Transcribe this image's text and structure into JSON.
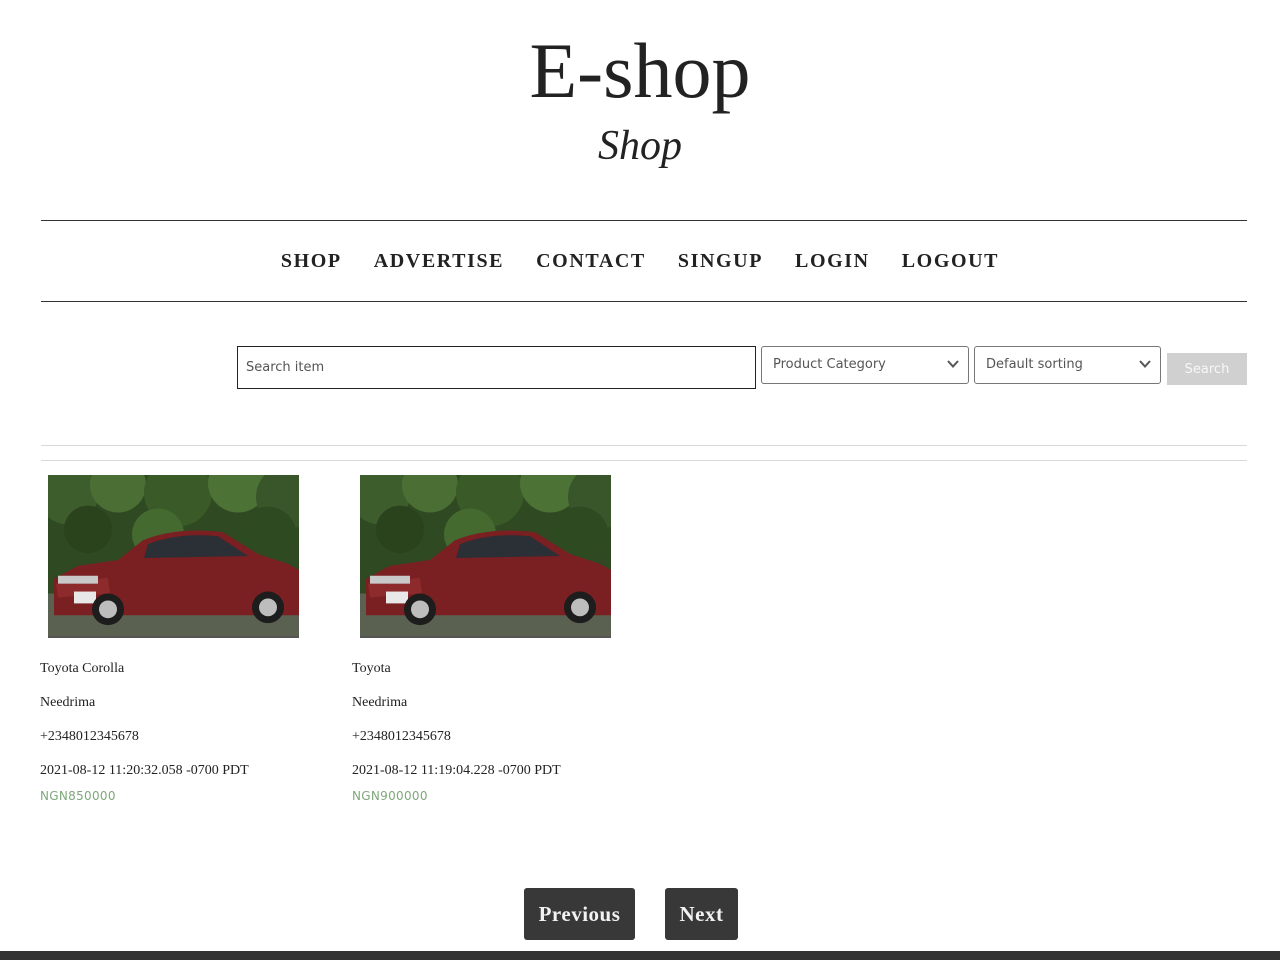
{
  "site": {
    "title": "E-shop",
    "subtitle": "Shop"
  },
  "nav": {
    "items": [
      "SHOP",
      "ADVERTISE",
      "CONTACT",
      "SINGUP",
      "LOGIN",
      "LOGOUT"
    ]
  },
  "filters": {
    "search_placeholder": "Search item",
    "search_value": "",
    "category_selected": "Product Category",
    "sorting_selected": "Default sorting",
    "search_button": "Search"
  },
  "products": [
    {
      "name": "Toyota Corolla",
      "seller": "Needrima",
      "phone": "+2348012345678",
      "date": "2021-08-12 11:20:32.058 -0700 PDT",
      "price": "NGN850000",
      "image_icon": "red-sedan-car-photo"
    },
    {
      "name": "Toyota",
      "seller": "Needrima",
      "phone": "+2348012345678",
      "date": "2021-08-12 11:19:04.228 -0700 PDT",
      "price": "NGN900000",
      "image_icon": "red-sedan-car-photo"
    }
  ],
  "pagination": {
    "previous": "Previous",
    "next": "Next"
  },
  "colors": {
    "price": "#7fa87a",
    "button_dark": "#383838",
    "search_button_bg": "#d0d0d0"
  }
}
